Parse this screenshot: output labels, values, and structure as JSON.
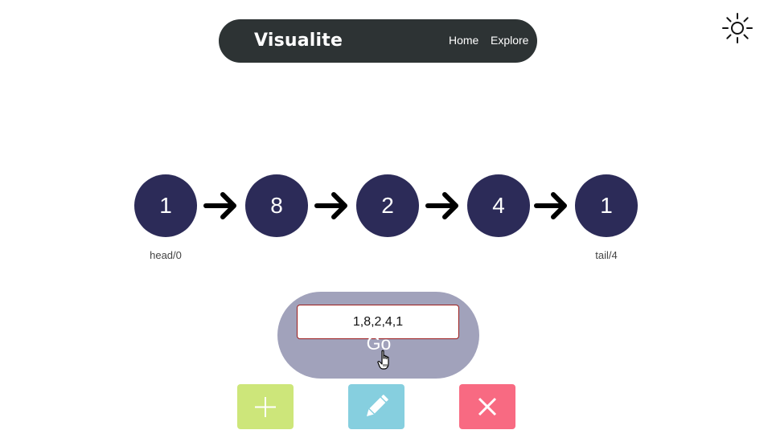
{
  "navbar": {
    "brand": "Visualite",
    "links": [
      "Home",
      "Explore"
    ]
  },
  "theme_toggle": {
    "icon": "sun-icon"
  },
  "linked_list": {
    "nodes": [
      "1",
      "8",
      "2",
      "4",
      "1"
    ],
    "head_label": "head/0",
    "tail_label": "tail/4",
    "node_color": "#2c2b58"
  },
  "input_panel": {
    "value": "1,8,2,4,1",
    "go_label": "Go"
  },
  "actions": {
    "add": {
      "icon": "plus-icon",
      "color": "#cde67a"
    },
    "edit": {
      "icon": "pencil-icon",
      "color": "#86cfdf"
    },
    "delete": {
      "icon": "close-icon",
      "color": "#f86a82"
    }
  }
}
